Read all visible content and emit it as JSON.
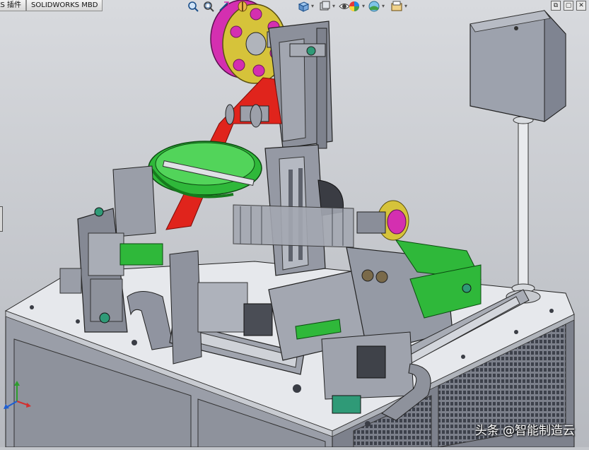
{
  "tabs": [
    {
      "label": "RKS 插件"
    },
    {
      "label": "SOLIDWORKS MBD"
    }
  ],
  "heads_up_toolbar": {
    "tools": [
      "zoom-to-fit-icon",
      "zoom-area-icon",
      "previous-view-icon",
      "section-view-icon",
      "view-orientation-icon",
      "display-style-icon",
      "hide-show-items-icon",
      "edit-appearance-icon",
      "apply-scene-icon",
      "view-settings-icon"
    ]
  },
  "window_controls": {
    "restore_label": "⧉",
    "maximize_label": "▢",
    "close_label": "✕"
  },
  "watermark": "头条 @智能制造云",
  "colors": {
    "background": "#c3c6cb",
    "part_gray": "#8b8f9a",
    "accent_green": "#2fb83a",
    "reel_magenta": "#d42fb0",
    "belt_red": "#e0241c",
    "reel_yellow": "#d6c33a"
  }
}
